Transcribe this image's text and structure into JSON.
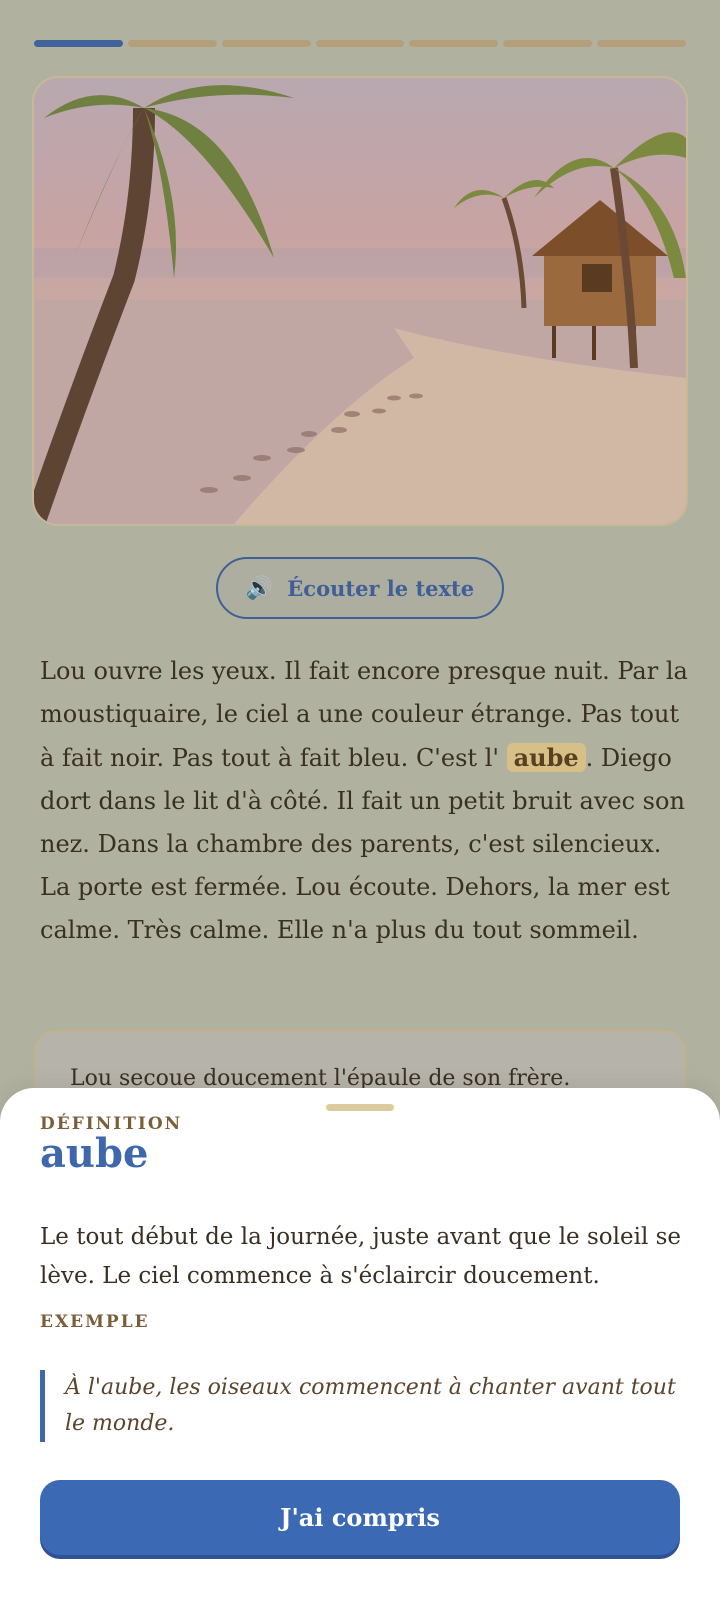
{
  "progress": {
    "total": 7,
    "current": 1
  },
  "illustration": {
    "alt_icon": "beach-dawn-illustration"
  },
  "listen_button": {
    "icon": "speaker-icon",
    "label": "Écouter le texte"
  },
  "story": {
    "before": "Lou ouvre les yeux. Il fait encore presque nuit. Par la moustiquaire, le ciel a une couleur étrange. Pas tout à fait noir. Pas tout à fait bleu. C'est l' ",
    "highlight": "aube",
    "after": ". Diego dort dans le lit d'à côté. Il fait un petit bruit avec son nez. Dans la chambre des parents, c'est silencieux. La porte est fermée. Lou écoute. Dehors, la mer est calme. Très calme. Elle n'a plus du tout sommeil."
  },
  "next_card": {
    "text": "Lou secoue doucement l'épaule de son frère."
  },
  "definition_sheet": {
    "caption": "DÉFINITION",
    "term": "aube",
    "definition": "Le tout début de la journée, juste avant que le soleil se lève. Le ciel commence à s'éclaircir doucement.",
    "example_caption": "EXEMPLE",
    "example": "À l'aube, les oiseaux commencent à chanter avant tout le monde.",
    "ok_label": "J'ai compris"
  },
  "colors": {
    "accent": "#3b69b3",
    "highlight": "#d7bf88",
    "progress_active": "#42629a"
  }
}
